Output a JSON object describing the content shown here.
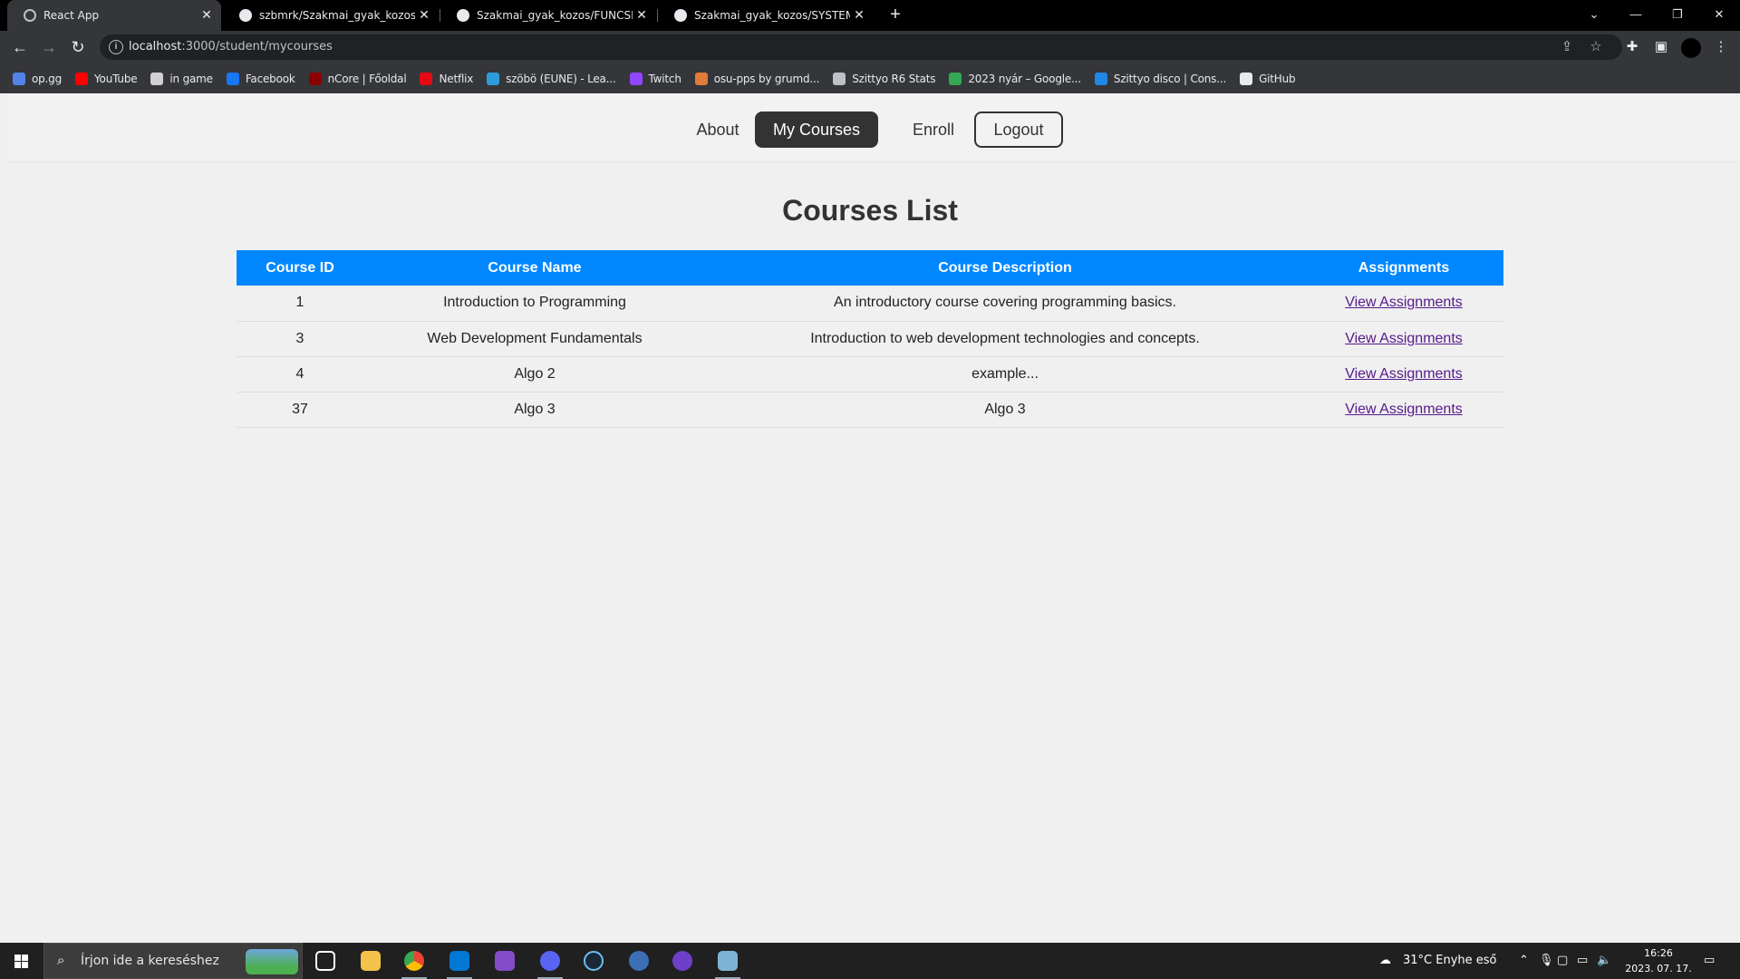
{
  "browser": {
    "tabs": [
      {
        "title": "React App",
        "active": true
      },
      {
        "title": "szbmrk/Szakmai_gyak_kozos",
        "active": false
      },
      {
        "title": "Szakmai_gyak_kozos/FUNCSPEC",
        "active": false
      },
      {
        "title": "Szakmai_gyak_kozos/SYSTEMPLA",
        "active": false
      }
    ],
    "url_host": "localhost",
    "url_path": ":3000/student/mycourses",
    "bookmarks": [
      {
        "label": "op.gg",
        "color": "#5383e8"
      },
      {
        "label": "YouTube",
        "color": "#ff0000"
      },
      {
        "label": "in game",
        "color": "#d0d0d0"
      },
      {
        "label": "Facebook",
        "color": "#1877f2"
      },
      {
        "label": "nCore | Főoldal",
        "color": "#8b0000"
      },
      {
        "label": "Netflix",
        "color": "#e50914"
      },
      {
        "label": "szöbö (EUNE) - Lea...",
        "color": "#2d9cdb"
      },
      {
        "label": "Twitch",
        "color": "#9146ff"
      },
      {
        "label": "osu-pps by grumd...",
        "color": "#e07b39"
      },
      {
        "label": "Szittyo R6 Stats",
        "color": "#bdc1c6"
      },
      {
        "label": "2023 nyár – Google...",
        "color": "#34a853"
      },
      {
        "label": "Szittyo disco | Cons...",
        "color": "#1e88e5"
      },
      {
        "label": "GitHub",
        "color": "#e8eaed"
      }
    ]
  },
  "nav": {
    "about": "About",
    "my_courses": "My Courses",
    "enroll": "Enroll",
    "logout": "Logout"
  },
  "page_title": "Courses List",
  "table": {
    "headers": [
      "Course ID",
      "Course Name",
      "Course Description",
      "Assignments"
    ],
    "rows": [
      {
        "id": "1",
        "name": "Introduction to Programming",
        "description": "An introductory course covering programming basics.",
        "link": "View Assignments"
      },
      {
        "id": "3",
        "name": "Web Development Fundamentals",
        "description": "Introduction to web development technologies and concepts.",
        "link": "View Assignments"
      },
      {
        "id": "4",
        "name": "Algo 2",
        "description": "example...",
        "link": "View Assignments"
      },
      {
        "id": "37",
        "name": "Algo 3",
        "description": "Algo 3",
        "link": "View Assignments"
      }
    ]
  },
  "taskbar": {
    "search_placeholder": "Írjon ide a kereséshez",
    "weather": "31°C  Enyhe eső",
    "time": "16:26",
    "date": "2023. 07. 17."
  },
  "colors": {
    "table_header": "#0087ff",
    "nav_active": "#333333",
    "link": "#551a8b"
  }
}
